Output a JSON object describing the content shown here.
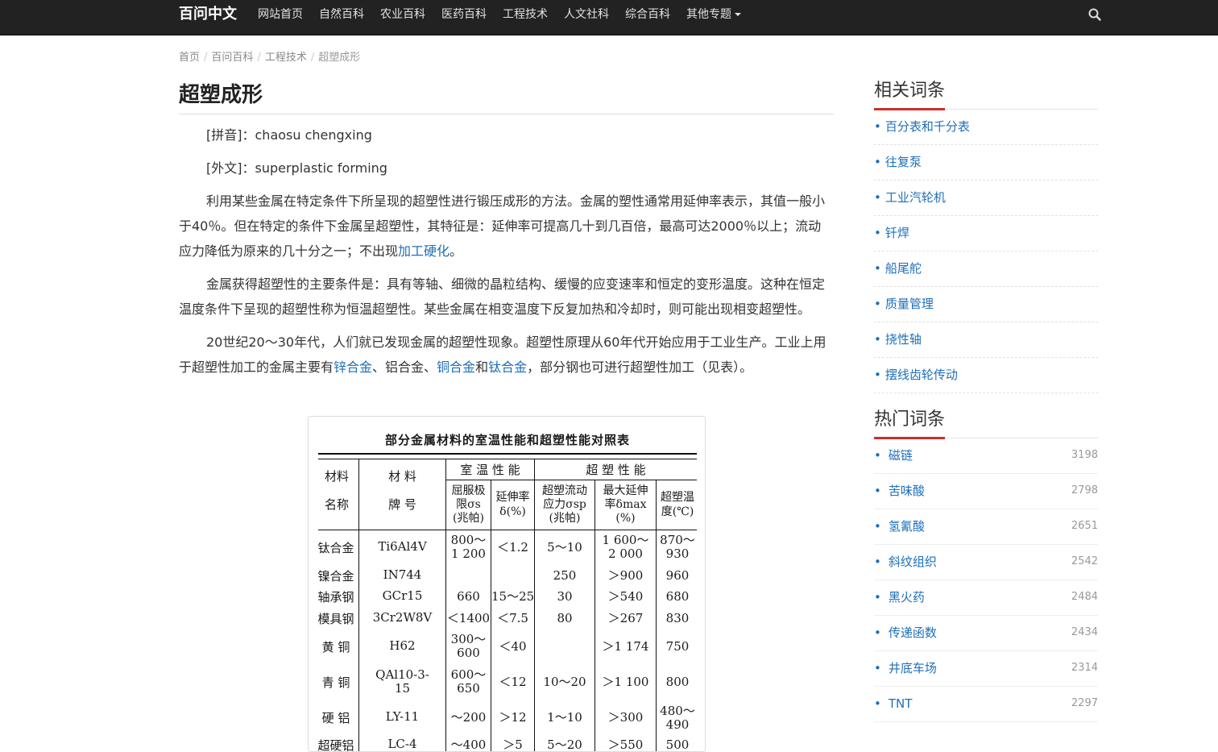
{
  "navbar": {
    "brand": "百问中文",
    "items": [
      "网站首页",
      "自然百科",
      "农业百科",
      "医药百科",
      "工程技术",
      "人文社科",
      "综合百科"
    ],
    "dropdown_label": "其他专题",
    "search_icon": "search-icon"
  },
  "breadcrumb": {
    "items": [
      "首页",
      "百问百科",
      "工程技术"
    ],
    "current": "超塑成形"
  },
  "article": {
    "title": "超塑成形",
    "pinyin_label": "[拼音]：",
    "pinyin": "chaosu chengxing",
    "foreign_label": "[外文]：",
    "foreign": "superplastic forming",
    "p1_a": "利用某些金属在特定条件下所呈现的超塑性进行锻压成形的方法。金属的塑性通常用延伸率表示，其值一般小于40％。但在特定的条件下金属呈超塑性，其特征是：延伸率可提高几十到几百倍，最高可达2000％以上；流动应力降低为原来的几十分之一；不出现",
    "p1_link": "加工硬化",
    "p1_b": "。",
    "p2": "金属获得超塑性的主要条件是：具有等轴、细微的晶粒结构、缓慢的应变速率和恒定的变形温度。这种在恒定温度条件下呈现的超塑性称为恒温超塑性。某些金属在相变温度下反复加热和冷却时，则可能出现相变超塑性。",
    "p3_a": "20世纪20～30年代，人们就已发现金属的超塑性现象。超塑性原理从60年代开始应用于工业生产。工业上用于超塑性加工的金属主要有",
    "p3_link1": "锌合金",
    "p3_b": "、铝合金、",
    "p3_link2": "铜合金",
    "p3_c": "和",
    "p3_link3": "钛合金",
    "p3_d": "，部分钢也可进行超塑性加工（见表）。"
  },
  "figure_table": {
    "title": "部分金属材料的室温性能和超塑性能对照表",
    "group_room": "室 温 性 能",
    "group_super": "超 塑 性 能",
    "h_name_1": "材料",
    "h_name_2": "名称",
    "h_grade_1": "材 料",
    "h_grade_2": "牌 号",
    "h_yield": [
      "屈服极",
      "限σs",
      "(兆帕)"
    ],
    "h_elong": [
      "延伸率",
      "δ(%)"
    ],
    "h_flow": [
      "超塑流动",
      "应力σsp",
      "(兆帕)"
    ],
    "h_maxel": [
      "最大延伸",
      "率δmax",
      "(%)"
    ],
    "h_temp": [
      "超塑温",
      "度(℃)"
    ],
    "rows": [
      {
        "name": "钛合金",
        "grade": "Ti6Al4V",
        "yield": [
          "800～",
          "1 200"
        ],
        "elong": "＜1.2",
        "flow": "5～10",
        "maxel": [
          "1 600～",
          "2 000"
        ],
        "temp": [
          "870～",
          "930"
        ]
      },
      {
        "name": "镍合金",
        "grade": "IN744",
        "yield": [
          ""
        ],
        "elong": "",
        "flow": "250",
        "maxel": [
          "＞900"
        ],
        "temp": [
          "960"
        ]
      },
      {
        "name": "轴承钢",
        "grade": "GCr15",
        "yield": [
          "660"
        ],
        "elong": "15～25",
        "flow": "30",
        "maxel": [
          "＞540"
        ],
        "temp": [
          "680"
        ]
      },
      {
        "name": "模具钢",
        "grade": "3Cr2W8V",
        "yield": [
          "＜1400"
        ],
        "elong": "＜7.5",
        "flow": "80",
        "maxel": [
          "＞267"
        ],
        "temp": [
          "830"
        ]
      },
      {
        "name": "黄 铜",
        "grade": "H62",
        "yield": [
          "300～",
          "600"
        ],
        "elong": "＜40",
        "flow": "",
        "maxel": [
          "＞1 174"
        ],
        "temp": [
          "750"
        ]
      },
      {
        "name": "青 铜",
        "grade": "QAl10-3-15",
        "yield": [
          "600～",
          "650"
        ],
        "elong": "＜12",
        "flow": "10～20",
        "maxel": [
          "＞1 100"
        ],
        "temp": [
          "800"
        ]
      },
      {
        "name": "硬 铝",
        "grade": "LY-11",
        "yield": [
          "～200"
        ],
        "elong": "＞12",
        "flow": "1～10",
        "maxel": [
          "＞300"
        ],
        "temp": [
          "480～",
          "490"
        ]
      },
      {
        "name": "超硬铝",
        "grade": "LC-4",
        "yield": [
          "～400"
        ],
        "elong": "＞5",
        "flow": "5～20",
        "maxel": [
          "＞550"
        ],
        "temp": [
          "500"
        ]
      }
    ]
  },
  "sidebar": {
    "related_title": "相关词条",
    "related": [
      "百分表和千分表",
      "往复泵",
      "工业汽轮机",
      "钎焊",
      "船尾舵",
      "质量管理",
      "挠性轴",
      "摆线齿轮传动"
    ],
    "hot_title": "热门词条",
    "hot": [
      {
        "name": "磁链",
        "count": "3198"
      },
      {
        "name": "苦味酸",
        "count": "2798"
      },
      {
        "name": "氢氰酸",
        "count": "2651"
      },
      {
        "name": "斜纹组织",
        "count": "2542"
      },
      {
        "name": "黑火药",
        "count": "2484"
      },
      {
        "name": "传递函数",
        "count": "2434"
      },
      {
        "name": "井底车场",
        "count": "2314"
      },
      {
        "name": "TNT",
        "count": "2297"
      }
    ]
  }
}
